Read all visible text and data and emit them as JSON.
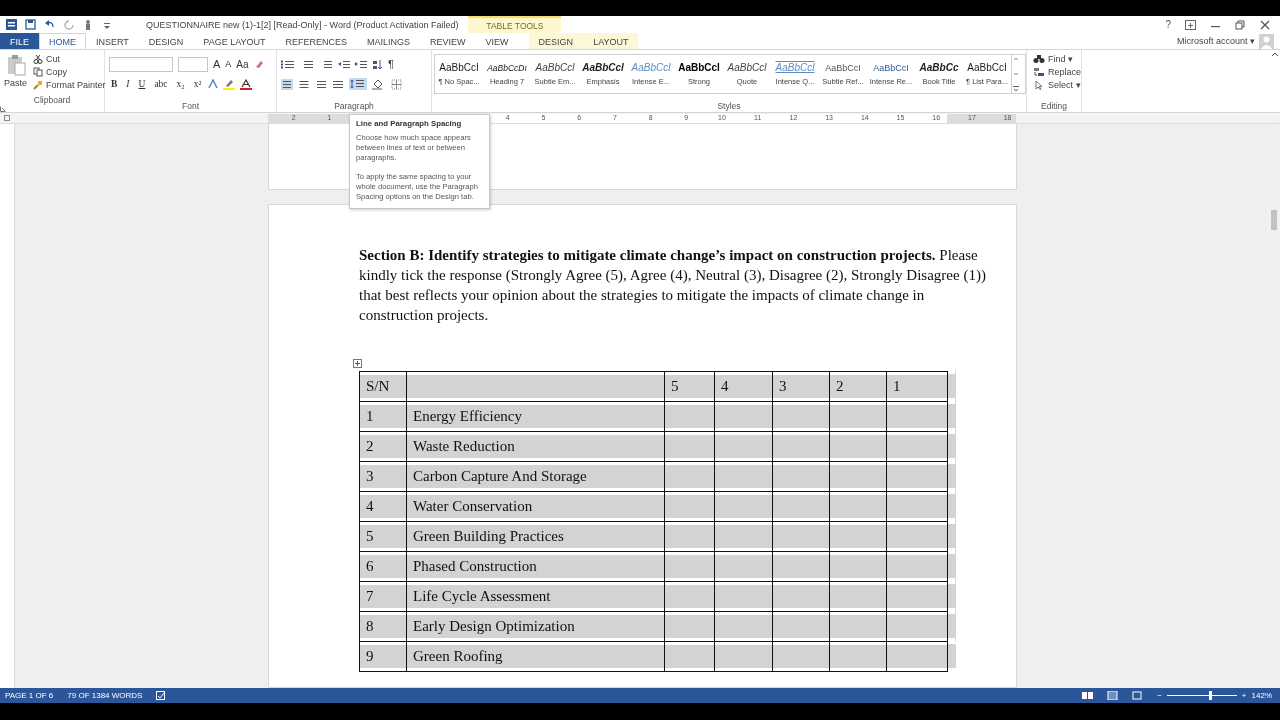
{
  "window": {
    "title": "QUESTIONNAIRE new (1)-1[2] [Read-Only] - Word (Product Activation Failed)",
    "contextual_group": "TABLE TOOLS",
    "help": "?",
    "account": "Microsoft account",
    "account_caret": "▾"
  },
  "tabs": [
    {
      "label": "FILE",
      "kind": "file",
      "selected": false,
      "contextual": false
    },
    {
      "label": "HOME",
      "kind": "tab",
      "selected": true,
      "contextual": false
    },
    {
      "label": "INSERT",
      "kind": "tab",
      "selected": false,
      "contextual": false
    },
    {
      "label": "DESIGN",
      "kind": "tab",
      "selected": false,
      "contextual": false
    },
    {
      "label": "PAGE LAYOUT",
      "kind": "tab",
      "selected": false,
      "contextual": false
    },
    {
      "label": "REFERENCES",
      "kind": "tab",
      "selected": false,
      "contextual": false
    },
    {
      "label": "MAILINGS",
      "kind": "tab",
      "selected": false,
      "contextual": false
    },
    {
      "label": "REVIEW",
      "kind": "tab",
      "selected": false,
      "contextual": false
    },
    {
      "label": "VIEW",
      "kind": "tab",
      "selected": false,
      "contextual": false
    },
    {
      "label": "DESIGN",
      "kind": "tab",
      "selected": false,
      "contextual": true
    },
    {
      "label": "LAYOUT",
      "kind": "tab",
      "selected": false,
      "contextual": true
    }
  ],
  "clipboard": {
    "paste": "Paste",
    "items": [
      {
        "label": "Cut",
        "kind": "cut"
      },
      {
        "label": "Copy",
        "kind": "copy"
      },
      {
        "label": "Format Painter",
        "kind": "painter"
      }
    ],
    "group": "Clipboard"
  },
  "font": {
    "group": "Font",
    "size_buttons": [
      {
        "label": "A",
        "kind": "grow"
      },
      {
        "label": "A",
        "kind": "shrink"
      },
      {
        "label": "Aa",
        "kind": "case"
      }
    ],
    "format_buttons": [
      "B",
      "I",
      "U",
      "abc",
      "x₂",
      "x²"
    ]
  },
  "paragraph": {
    "group": "Paragraph",
    "pilcrow": "¶"
  },
  "styles": {
    "group": "Styles",
    "items": [
      {
        "sample": "AaBbCcI",
        "name": "¶ No Spac..."
      },
      {
        "sample": "AaBbCcDı",
        "name": "Heading 7"
      },
      {
        "sample": "AaBbCcl",
        "name": "Subtle Em..."
      },
      {
        "sample": "AaBbCcl",
        "name": "Emphasis"
      },
      {
        "sample": "AaBbCcl",
        "name": "Intense E..."
      },
      {
        "sample": "AaBbCcl",
        "name": "Strong"
      },
      {
        "sample": "AaBbCcl",
        "name": "Quote"
      },
      {
        "sample": "AaBbCcl",
        "name": "Intense Q..."
      },
      {
        "sample": "AaBbCcI",
        "name": "Subtle Ref..."
      },
      {
        "sample": "AaBbCcI",
        "name": "Intense Re..."
      },
      {
        "sample": "AaBbCc",
        "name": "Book Title"
      },
      {
        "sample": "AaBbCcI",
        "name": "¶ List Para..."
      }
    ]
  },
  "editing": {
    "group": "Editing",
    "items": [
      {
        "label": "Find",
        "kind": "find",
        "caret": "▾"
      },
      {
        "label": "Replace",
        "kind": "replace"
      },
      {
        "label": "Select",
        "kind": "select",
        "caret": "▾"
      }
    ]
  },
  "ruler": {
    "labels": [
      "2",
      "1",
      "4",
      "5",
      "6",
      "7",
      "8",
      "9",
      "10",
      "11",
      "12",
      "13",
      "14",
      "15",
      "16",
      "17",
      "18"
    ]
  },
  "tooltip": {
    "title": "Line and Paragraph Spacing",
    "lines": [
      "Choose how much space appears between lines of text or between paragraphs.",
      "To apply the same spacing to your whole document, use the Paragraph Spacing options on the Design tab."
    ]
  },
  "document": {
    "paragraph": "**Section B: Identify strategies to mitigate climate change’s impact on construction projects.**  Please kindly tick the response (Strongly Agree (5), Agree (4), Neutral (3), Disagree (2), Strongly Disagree (1)) that best reflects your opinion about the strategies to mitigate the impacts of climate change in construction projects.",
    "table": {
      "columns": [
        "S/N",
        "",
        "5",
        "4",
        "3",
        "2",
        "1"
      ],
      "selected": true,
      "rows": [
        [
          "1",
          "Energy Efficiency"
        ],
        [
          "2",
          "Waste Reduction"
        ],
        [
          "3",
          "Carbon Capture And Storage"
        ],
        [
          "4",
          "Water Conservation"
        ],
        [
          "5",
          "Green Building Practices"
        ],
        [
          "6",
          "Phased Construction"
        ],
        [
          "7",
          "Life Cycle Assessment"
        ],
        [
          "8",
          "Early Design Optimization"
        ],
        [
          "9",
          "Green Roofing"
        ]
      ]
    }
  },
  "status_bar": {
    "page": "PAGE 1 OF 6",
    "words": "79 OF 1384 WORDS",
    "zoom": "142%",
    "zoom_out": "−",
    "zoom_in": "+",
    "zoom_slider": {
      "level": 0.6
    }
  }
}
